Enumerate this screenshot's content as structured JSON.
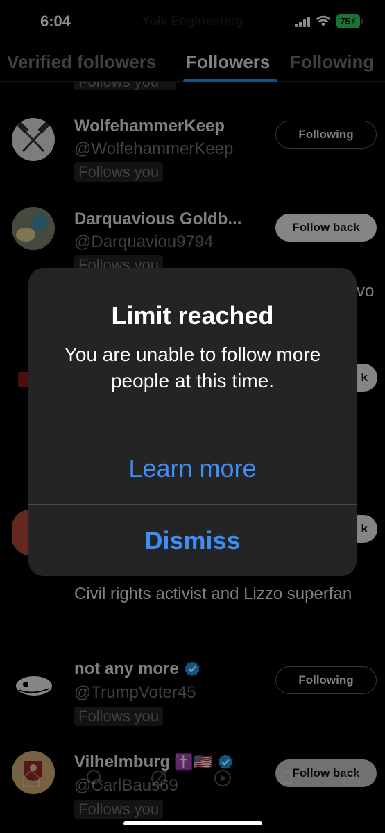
{
  "status_bar": {
    "time": "6:04",
    "behind_title": "Yolk Engineering",
    "battery": "75"
  },
  "tabs": [
    {
      "label": "Verified followers"
    },
    {
      "label": "Followers"
    },
    {
      "label": "Following"
    }
  ],
  "active_tab": "Followers",
  "partial_badge": "Follows you",
  "users": [
    {
      "name": "WolfehammerKeep",
      "handle": "@WolfehammerKeep",
      "badge": "Follows you",
      "button": "Following"
    },
    {
      "name": "Darquavious Goldb...",
      "handle": "@Darquaviou9794",
      "badge": "Follows you",
      "button": "Follow back"
    },
    {
      "bio": "Civil rights activist and Lizzo superfan"
    },
    {
      "name": "not any more",
      "handle": "@TrumpVoter45",
      "badge": "Follows you",
      "button": "Following"
    },
    {
      "name": "Vilhelmburg",
      "name_emoji": "✝️🇺🇸",
      "handle": "@CarlBaus69",
      "badge": "Follows you",
      "button": "Follow back"
    }
  ],
  "peek_text": {
    "right_edge": "vo",
    "button_edge": "k"
  },
  "alert": {
    "title": "Limit reached",
    "message": "You are unable to follow more people at this time.",
    "learn_more": "Learn more",
    "dismiss": "Dismiss"
  },
  "colors": {
    "background": "#000000",
    "accent": "#1d9bf0",
    "alert_button": "#3d8ff5",
    "muted_text": "#71767b",
    "battery": "#30d158"
  },
  "icons": [
    "home-icon",
    "search-icon",
    "grok-icon",
    "play-icon",
    "bell-icon",
    "mail-icon"
  ]
}
